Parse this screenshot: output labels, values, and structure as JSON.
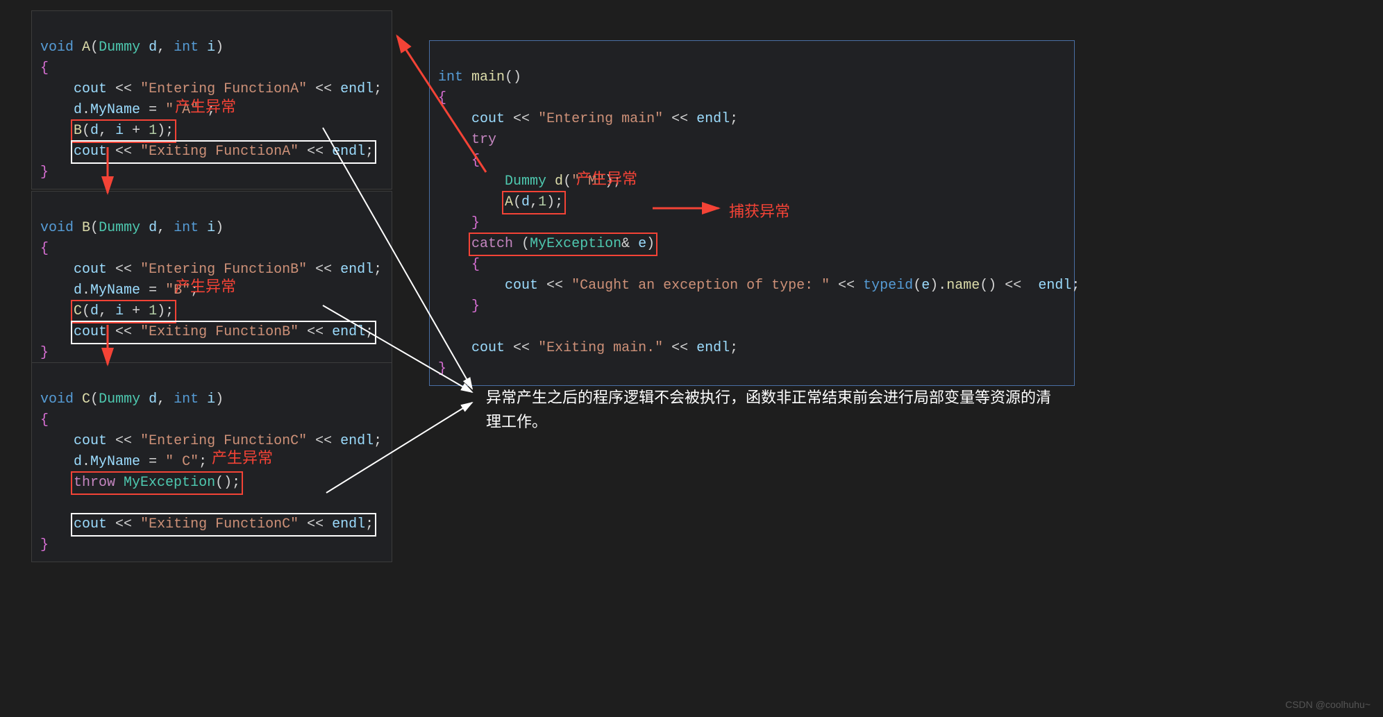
{
  "blockA": {
    "sig_void": "void",
    "sig_fn": "A",
    "sig_type": "Dummy",
    "sig_d": "d",
    "sig_int": "int",
    "sig_i": "i",
    "enter_pre": "cout ",
    "enter_op": "<<",
    "enter_str": "\"Entering FunctionA\"",
    "enter_post": " endl",
    "myname_d": "d",
    "myname_prop": "MyName",
    "myname_eq": " = ",
    "myname_str": "\" A\" ",
    "call_fn": "B",
    "call_d": "d",
    "call_i": "i",
    "call_plus": " + ",
    "call_num": "1",
    "exit_pre": "cout ",
    "exit_op": "<<",
    "exit_str": "\"Exiting FunctionA\"",
    "exit_post": " endl",
    "annot": "产生异常"
  },
  "blockB": {
    "sig_void": "void",
    "sig_fn": "B",
    "sig_type": "Dummy",
    "sig_d": "d",
    "sig_int": "int",
    "sig_i": "i",
    "enter_pre": "cout ",
    "enter_op": "<<",
    "enter_str": "\"Entering FunctionB\"",
    "enter_post": " endl",
    "myname_d": "d",
    "myname_prop": "MyName",
    "myname_eq": " = ",
    "myname_str": "\"B\"",
    "call_fn": "C",
    "call_d": "d",
    "call_i": "i",
    "call_plus": " + ",
    "call_num": "1",
    "exit_pre": "cout ",
    "exit_op": "<<",
    "exit_str": "\"Exiting FunctionB\"",
    "exit_post": " endl",
    "annot": "产生异常"
  },
  "blockC": {
    "sig_void": "void",
    "sig_fn": "C",
    "sig_type": "Dummy",
    "sig_d": "d",
    "sig_int": "int",
    "sig_i": "i",
    "enter_pre": "cout ",
    "enter_op": "<<",
    "enter_str": "\"Entering FunctionC\"",
    "enter_post": " endl",
    "myname_d": "d",
    "myname_prop": "MyName",
    "myname_eq": " = ",
    "myname_str": "\" C\"",
    "throw_kw": "throw",
    "throw_cls": "MyException",
    "exit_pre": "cout ",
    "exit_op": "<<",
    "exit_str": "\"Exiting FunctionC\"",
    "exit_post": " endl",
    "annot": "产生异常"
  },
  "main": {
    "sig_int": "int",
    "sig_fn": "main",
    "enter_pre": "cout ",
    "enter_op": "<<",
    "enter_str": "\"Entering main\"",
    "enter_post": " endl",
    "try_kw": "try",
    "dummy_cls": "Dummy",
    "dummy_var": "d",
    "dummy_arg": "\" M\"",
    "call_fn": "A",
    "call_d": "d",
    "call_num": "1",
    "call_annot": "产生异常",
    "catch_kw": "catch",
    "catch_cls": "MyException",
    "catch_amp": "&",
    "catch_var": " e",
    "catch_annot": "捕获异常",
    "caught_pre": "cout ",
    "caught_op": "<<",
    "caught_str": "\"Caught an exception of type: \"",
    "typeid_fn": "typeid",
    "typeid_e": "e",
    "name_fn": "name",
    "exiting_pre": "cout ",
    "exiting_str": "\"Exiting main.\"",
    "exiting_post": " endl"
  },
  "explain": "异常产生之后的程序逻辑不会被执行，函数非正常结束前会进行局部变量等资源的清理工作。",
  "watermark": "CSDN @coolhuhu~"
}
